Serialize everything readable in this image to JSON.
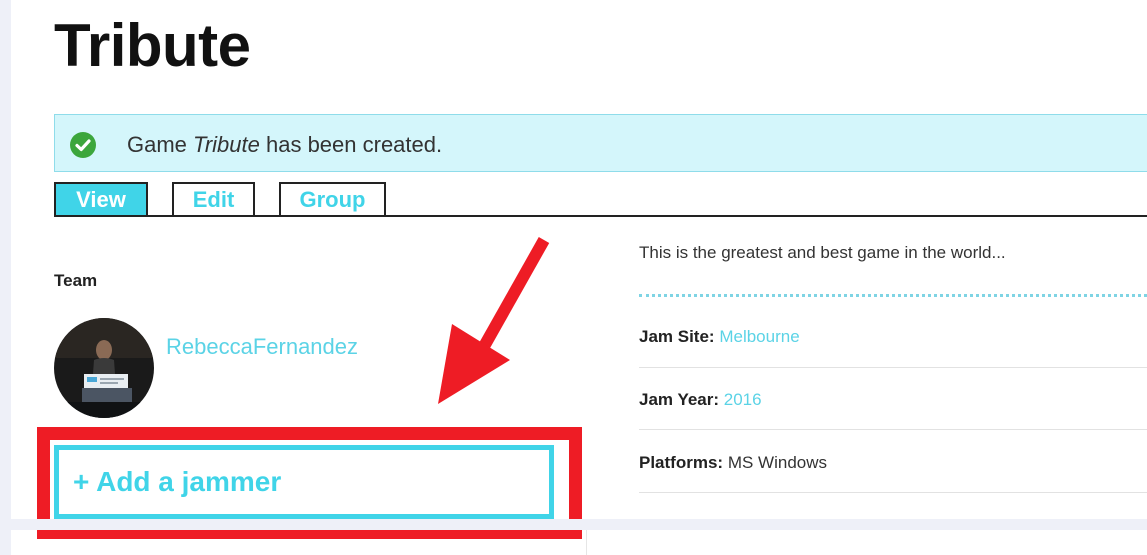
{
  "page": {
    "title": "Tribute"
  },
  "alert": {
    "prefix": "Game ",
    "game_name": "Tribute",
    "suffix": " has been created.",
    "icon": "check-circle-icon",
    "color": "#d4f6fb"
  },
  "tabs": [
    {
      "label": "View",
      "active": true
    },
    {
      "label": "Edit",
      "active": false
    },
    {
      "label": "Group",
      "active": false
    }
  ],
  "team": {
    "label": "Team",
    "members": [
      {
        "name": "RebeccaFernandez"
      }
    ],
    "add_button_label": "+ Add a jammer"
  },
  "details": {
    "description": "This is the greatest and best game in the world...",
    "jam_site_label": "Jam Site:",
    "jam_site_value": "Melbourne",
    "jam_year_label": "Jam Year:",
    "jam_year_value": "2016",
    "platforms_label": "Platforms:",
    "platforms_value": "MS Windows"
  },
  "colors": {
    "accent": "#40d4e8",
    "link": "#5bd3e6",
    "annotation_red": "#ee1c25"
  }
}
